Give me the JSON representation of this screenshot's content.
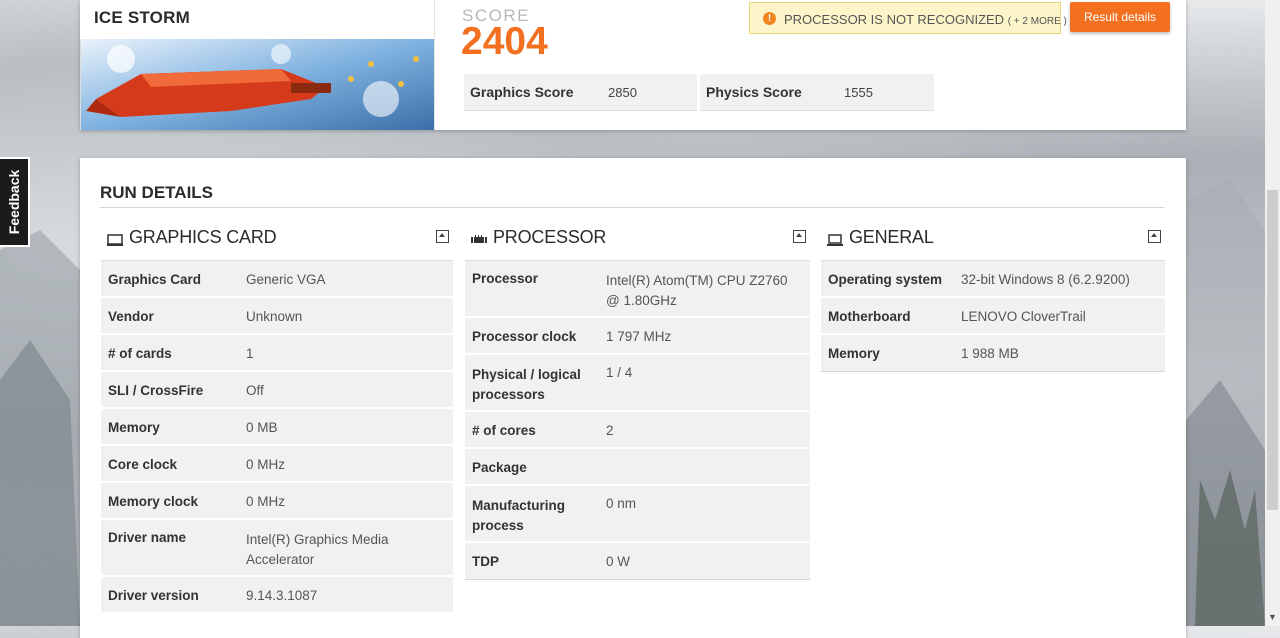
{
  "test": {
    "title": "ICE STORM",
    "score_label": "SCORE",
    "score": "2404",
    "graphics_score_label": "Graphics Score",
    "graphics_score": "2850",
    "physics_score_label": "Physics Score",
    "physics_score": "1555"
  },
  "warning": {
    "icon": "warning-icon",
    "text": "PROCESSOR IS NOT RECOGNIZED",
    "more": "( + 2 MORE )"
  },
  "result_button": "Result details",
  "feedback": "Feedback",
  "run_details": {
    "title": "RUN DETAILS",
    "graphics_card": {
      "title": "GRAPHICS CARD",
      "icon": "monitor-icon",
      "rows": [
        {
          "k": "Graphics Card",
          "v": "Generic VGA"
        },
        {
          "k": "Vendor",
          "v": "Unknown"
        },
        {
          "k": "# of cards",
          "v": "1"
        },
        {
          "k": "SLI / CrossFire",
          "v": "Off"
        },
        {
          "k": "Memory",
          "v": "0 MB"
        },
        {
          "k": "Core clock",
          "v": "0 MHz"
        },
        {
          "k": "Memory clock",
          "v": "0 MHz"
        },
        {
          "k": "Driver name",
          "v": "Intel(R) Graphics Media Accelerator"
        },
        {
          "k": "Driver version",
          "v": "9.14.3.1087"
        }
      ]
    },
    "processor": {
      "title": "PROCESSOR",
      "icon": "cpu-icon",
      "rows": [
        {
          "k": "Processor",
          "v": "Intel(R) Atom(TM) CPU Z2760 @ 1.80GHz"
        },
        {
          "k": "Processor clock",
          "v": "1 797 MHz"
        },
        {
          "k": "Physical / logical processors",
          "v": "1 / 4"
        },
        {
          "k": "# of cores",
          "v": "2"
        },
        {
          "k": "Package",
          "v": ""
        },
        {
          "k": "Manufacturing process",
          "v": "0 nm"
        },
        {
          "k": "TDP",
          "v": "0 W"
        }
      ]
    },
    "general": {
      "title": "GENERAL",
      "icon": "laptop-icon",
      "rows": [
        {
          "k": "Operating system",
          "v": "32-bit Windows 8 (6.2.9200)"
        },
        {
          "k": "Motherboard",
          "v": "LENOVO CloverTrail"
        },
        {
          "k": "Memory",
          "v": "1 988 MB"
        }
      ]
    }
  },
  "colors": {
    "accent": "#f37021",
    "warning_bg": "#fcf5c9"
  }
}
